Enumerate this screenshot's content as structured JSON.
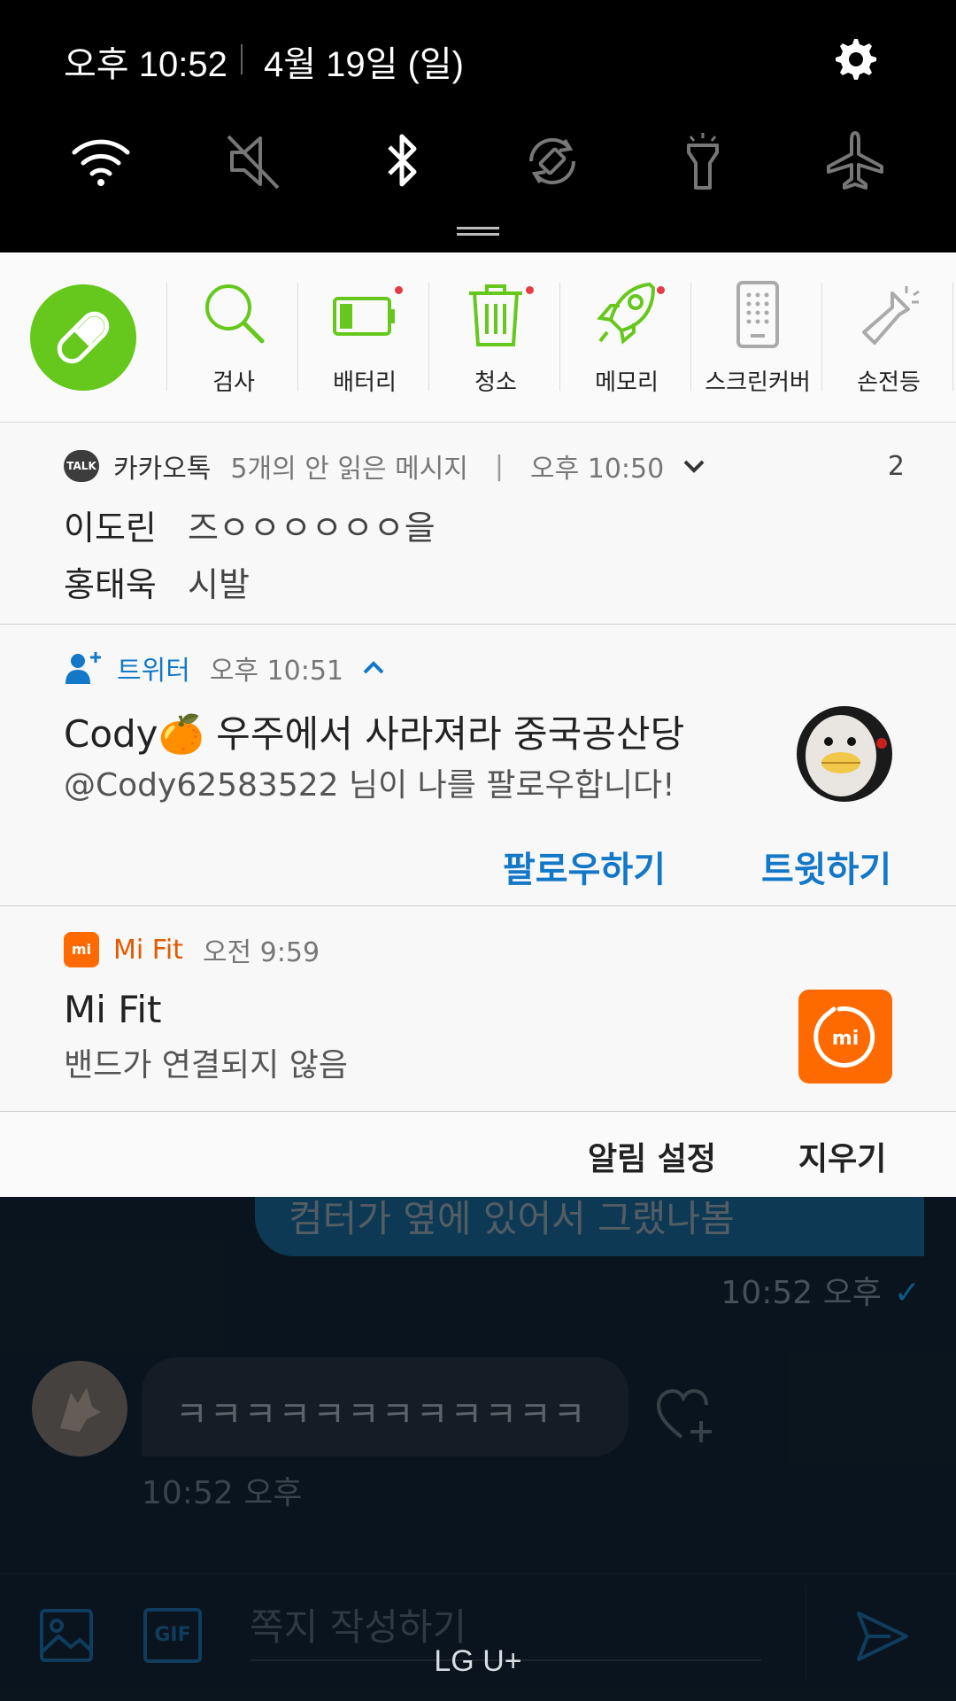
{
  "status_bar": {
    "time": "오후 10:52",
    "date": "4월 19일 (일)"
  },
  "quick_toggles": [
    {
      "name": "wifi-icon",
      "state": "on"
    },
    {
      "name": "sound-off-icon",
      "state": "off"
    },
    {
      "name": "bluetooth-icon",
      "state": "on"
    },
    {
      "name": "auto-rotate-icon",
      "state": "off"
    },
    {
      "name": "flashlight-icon",
      "state": "off"
    },
    {
      "name": "airplane-mode-icon",
      "state": "off"
    }
  ],
  "device_maintenance": {
    "accent_color": "#66c81c",
    "items": [
      {
        "label": "검사",
        "icon": "search-icon",
        "badge": false
      },
      {
        "label": "배터리",
        "icon": "battery-icon",
        "badge": true
      },
      {
        "label": "청소",
        "icon": "trash-icon",
        "badge": true
      },
      {
        "label": "메모리",
        "icon": "rocket-icon",
        "badge": true
      },
      {
        "label": "스크린커버",
        "icon": "screen-cover-icon",
        "badge": false
      },
      {
        "label": "손전등",
        "icon": "flashlight-icon",
        "badge": false
      }
    ]
  },
  "notifications": {
    "kakao": {
      "app": "카카오톡",
      "summary": "5개의 안 읽은 메시지",
      "time": "오후 10:50",
      "count": "2",
      "icon_text": "TALK",
      "messages": [
        {
          "sender": "이도린",
          "text": "즈ㅇㅇㅇㅇㅇㅇ을"
        },
        {
          "sender": "홍태욱",
          "text": "시발"
        }
      ]
    },
    "twitter": {
      "app": "트위터",
      "time": "오후 10:51",
      "title": "Cody🍊 우주에서 사라져라 중국공산당",
      "body": "@Cody62583522 님이 나를 팔로우합니다!",
      "actions": [
        "팔로우하기",
        "트윗하기"
      ],
      "accent_color": "#1478c8"
    },
    "mifit": {
      "app": "Mi Fit",
      "time": "오전 9:59",
      "title": "Mi Fit",
      "body": "밴드가 연결되지 않음",
      "accent_color": "#ff6a00",
      "logo_text": "mi"
    }
  },
  "notif_actions": {
    "settings": "알림 설정",
    "clear": "지우기"
  },
  "background_chat": {
    "sent_message": "컴터가 옆에 있어서 그랬나봄",
    "sent_time": "10:52 오후",
    "received_message": "ㅋㅋㅋㅋㅋㅋㅋㅋㅋㅋㅋㅋ",
    "received_time": "10:52 오후",
    "compose_placeholder": "쪽지 작성하기",
    "gif_label": "GIF",
    "carrier": "LG U+"
  }
}
